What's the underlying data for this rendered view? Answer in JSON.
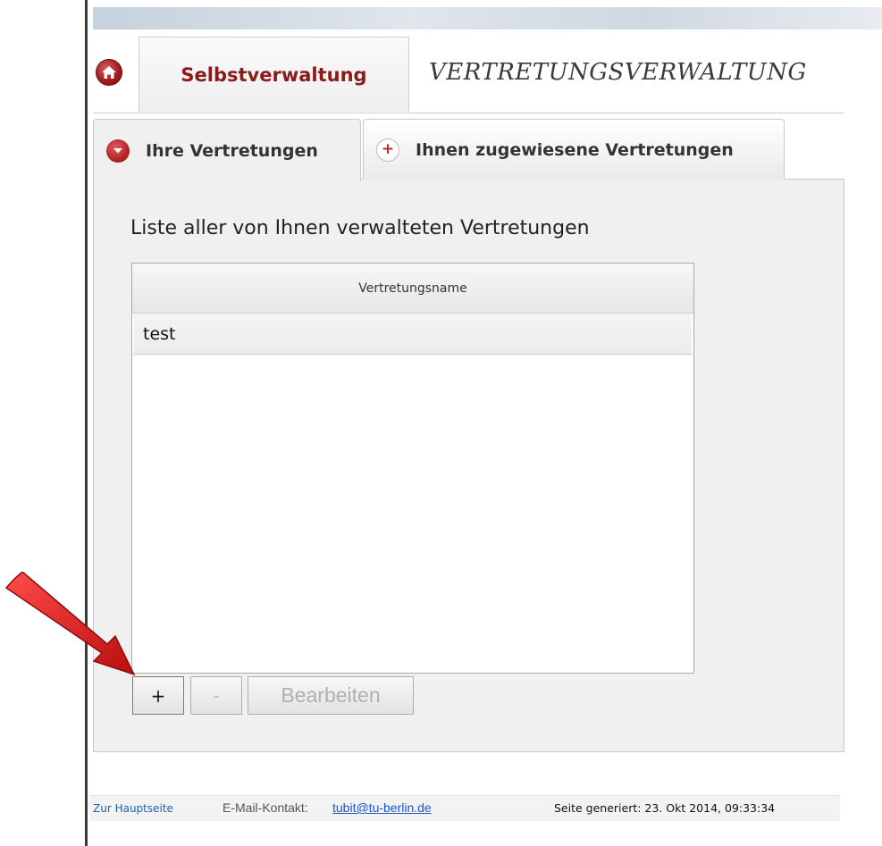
{
  "header": {
    "home_tab_label": "Selbstverwaltung",
    "page_title": "VERTRETUNGSVERWALTUNG"
  },
  "tabs": [
    {
      "label": "Ihre Vertretungen",
      "active": true
    },
    {
      "label": "Ihnen zugewiesene Vertretungen",
      "active": false
    }
  ],
  "main": {
    "list_heading": "Liste aller von Ihnen verwalteten Vertretungen",
    "table": {
      "columns": [
        "Vertretungsname"
      ],
      "rows": [
        [
          "test"
        ]
      ]
    },
    "buttons": {
      "add_label": "+",
      "remove_label": "-",
      "edit_label": "Bearbeiten"
    }
  },
  "footer": {
    "home_link": "Zur Hauptseite",
    "contact_label": "E-Mail-Kontakt:",
    "contact_email": "tubit@tu-berlin.de",
    "generated": "Seite generiert: 23. Okt 2014, 09:33:34"
  },
  "icons": {
    "home": "home-icon",
    "tab_active": "collapse-icon",
    "tab_inactive": "plus-icon",
    "annotation": "red-arrow-icon"
  },
  "colors": {
    "brand_red": "#8b1a1a",
    "link_blue": "#1a5fb4",
    "arrow_red": "#d61a1a"
  }
}
